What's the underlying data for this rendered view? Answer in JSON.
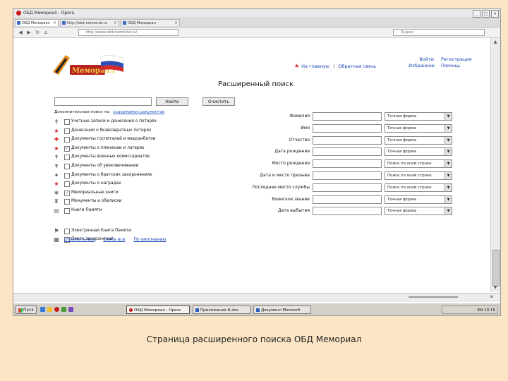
{
  "browser": {
    "window_title": "ОБД Мемориал - Opera",
    "tabs": [
      {
        "label": "ОБД Мемориал"
      },
      {
        "label": "http://obd-memorial.ru"
      },
      {
        "label": "ОБД Мемориал"
      }
    ],
    "address": "http://www.obd-memorial.ru/",
    "search_placeholder": "Яндекс"
  },
  "site": {
    "logo_text": "Мемориал",
    "nav": {
      "home": "На главную",
      "separator": "|",
      "feedback": "Обратная связь",
      "login": "Войти",
      "register": "Регистрация",
      "favorites": "Избранное",
      "help": "Помощь"
    },
    "heading": "Расширенный поиск",
    "search": {
      "query_value": "",
      "find_button": "Найти",
      "clear_button": "Очистить"
    },
    "additional_label": "Дополнительные поиск по:",
    "additional_link": "содержимое документов",
    "categories": [
      {
        "label": "Учетные записи и донесения о потерях",
        "checked": false,
        "icon": "✝"
      },
      {
        "label": "Донесения о безвозвратных потерях",
        "checked": false,
        "icon": "★"
      },
      {
        "label": "Документы госпиталей и медсанбатов",
        "checked": false,
        "icon": "✚"
      },
      {
        "label": "Документы о пленении и лагерях",
        "checked": true,
        "icon": "★"
      },
      {
        "label": "Документы военных комиссариатов",
        "checked": false,
        "icon": "✝"
      },
      {
        "label": "Документы об увековечивании",
        "checked": false,
        "icon": "✝"
      },
      {
        "label": "Документы о братских захоронениях",
        "checked": false,
        "icon": "✦"
      },
      {
        "label": "Документы о наградах",
        "checked": false,
        "icon": "★"
      },
      {
        "label": "Мемориальные книги",
        "checked": true,
        "icon": "✱"
      },
      {
        "label": "Монументы и обелиски",
        "checked": false,
        "icon": "♜"
      },
      {
        "label": "Книги Памяти",
        "checked": false,
        "icon": "▤"
      },
      {
        "label": "Электронная Книга Памяти",
        "checked": false,
        "icon": "⚑"
      },
      {
        "label": "Поиск захоронений",
        "checked": false,
        "icon": "▦"
      }
    ],
    "bottom_links": {
      "select_all": "Отметить все",
      "clear_all": "Снять все",
      "default": "По умолчанию"
    },
    "fields": [
      {
        "label": "Фамилия",
        "option": "Точная форма"
      },
      {
        "label": "Имя",
        "option": "Точная форма"
      },
      {
        "label": "Отчество",
        "option": "Точная форма"
      },
      {
        "label": "Дата рождения",
        "option": "Точная форма"
      },
      {
        "label": "Место рождения",
        "option": "Поиск по всей строке"
      },
      {
        "label": "Дата и место призыва",
        "option": "Поиск по всей строке"
      },
      {
        "label": "Последнее место службы",
        "option": "Поиск по всей строке"
      },
      {
        "label": "Воинское звание",
        "option": "Точная форма"
      },
      {
        "label": "Дата выбытия",
        "option": "Точная форма"
      }
    ]
  },
  "taskbar": {
    "start": "Пуск",
    "windows": [
      {
        "label": "ОБД Мемориал - Opera"
      },
      {
        "label": "Приложение Б.doc"
      },
      {
        "label": "Документ Microsoft"
      }
    ],
    "tray_time": "EN 10:15"
  },
  "caption": "Страница расширенного поиска ОБД Мемориал",
  "colors": {
    "link": "#1a44b8",
    "accent_red": "#d21b1b",
    "background": "#fbe5c4"
  }
}
